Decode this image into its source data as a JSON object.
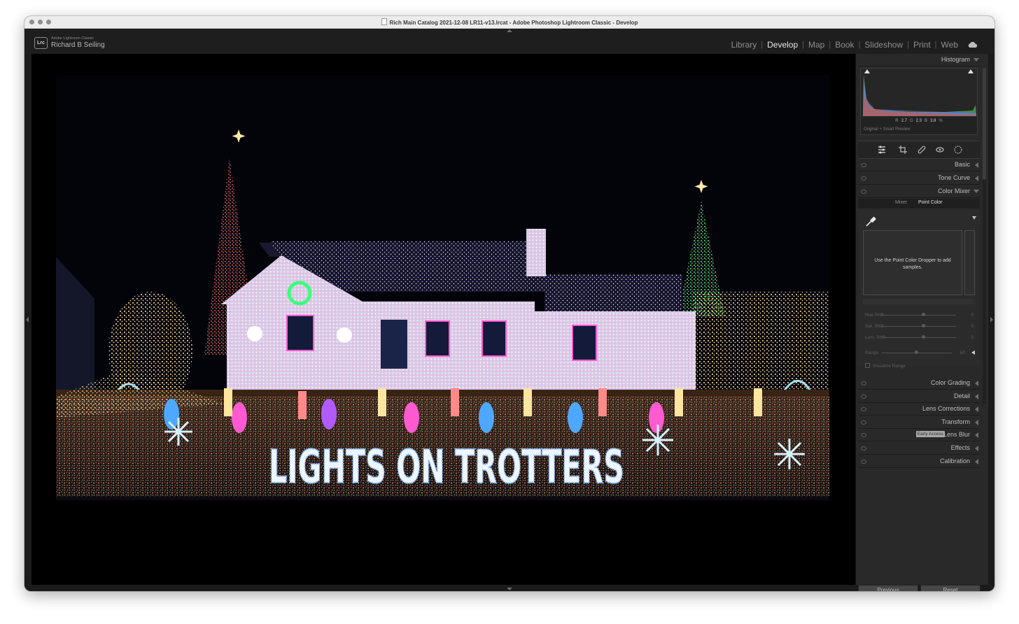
{
  "window": {
    "title": "Rich Main Catalog 2021-12-08 LR11-v13.lrcat - Adobe Photoshop Lightroom Classic - Develop"
  },
  "identity": {
    "badge": "Lrc",
    "product": "Adobe Lightroom Classic",
    "user": "Richard B Seiling"
  },
  "modules": {
    "items": [
      "Library",
      "Develop",
      "Map",
      "Book",
      "Slideshow",
      "Print",
      "Web"
    ],
    "active": "Develop"
  },
  "photo": {
    "sign_text": "LIGHTS ON TROTTERS"
  },
  "histogram": {
    "title": "Histogram",
    "r_label": "R",
    "r_value": "2.7",
    "g_label": "G",
    "g_value": "2.3",
    "b_label": "B",
    "b_value": "3.8",
    "unit": "%",
    "caption": "Original + Smart Preview"
  },
  "panels": {
    "basic": "Basic",
    "tone_curve": "Tone Curve",
    "color_mixer": "Color Mixer",
    "color_grading": "Color Grading",
    "detail": "Detail",
    "lens_corrections": "Lens Corrections",
    "transform": "Transform",
    "lens_blur": "Lens Blur",
    "early_access": "Early Access",
    "effects": "Effects",
    "calibration": "Calibration"
  },
  "color_mixer": {
    "tab_mixer": "Mixer",
    "tab_point_color": "Point Color",
    "active_tab": "Point Color",
    "dropper_message": "Use the Point Color Dropper to add samples.",
    "hue_shift_label": "Hue Shift",
    "hue_shift_value": "0",
    "sat_shift_label": "Sat. Shift",
    "sat_shift_value": "0",
    "lum_shift_label": "Lum. Shift",
    "lum_shift_value": "0",
    "range_label": "Range",
    "range_value": "50",
    "visualize_label": "Visualize Range"
  },
  "buttons": {
    "previous": "Previous",
    "reset": "Reset"
  },
  "colors": {
    "chrome": "#1b1b1b",
    "panel": "#292929",
    "viewer": "#000000",
    "active_text": "#e8e8e8"
  }
}
